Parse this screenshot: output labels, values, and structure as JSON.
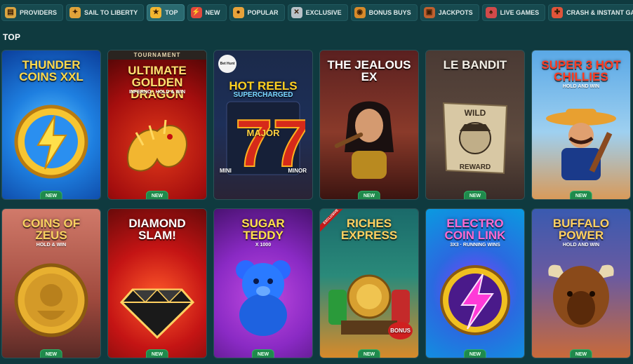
{
  "categories": [
    {
      "label": "Providers",
      "icon": "providers-icon",
      "color": "#d9a441",
      "active": false
    },
    {
      "label": "Sail to Liberty",
      "icon": "compass-icon",
      "color": "#e0a33a",
      "active": false
    },
    {
      "label": "Top",
      "icon": "star-icon",
      "color": "#f2b530",
      "active": true
    },
    {
      "label": "New",
      "icon": "lightning-icon",
      "color": "#e2483c",
      "active": false
    },
    {
      "label": "Popular",
      "icon": "coin-icon",
      "color": "#e8a23a",
      "active": false
    },
    {
      "label": "Exclusive",
      "icon": "crossed-swords-icon",
      "color": "#b9c2c8",
      "active": false
    },
    {
      "label": "Bonus Buys",
      "icon": "coin-bag-icon",
      "color": "#d88a2a",
      "active": false
    },
    {
      "label": "Jackpots",
      "icon": "treasure-chest-icon",
      "color": "#c0602e",
      "active": false
    },
    {
      "label": "Live Games",
      "icon": "cards-icon",
      "color": "#d24a4a",
      "active": false
    },
    {
      "label": "Crash & Instant Games",
      "icon": "gamepad-icon",
      "color": "#e0543a",
      "active": false
    }
  ],
  "section": {
    "title": "TOP"
  },
  "games": [
    {
      "name": "Thunder Coins XXL",
      "line1": "Thunder",
      "line2": "Coins XXL",
      "badge": "NEW",
      "theme": "blue"
    },
    {
      "name": "Ultimate Golden Dragon Inferno",
      "ribbon": "TOURNAMENT",
      "line1": "Ultimate",
      "line2": "Golden Dragon",
      "subtitle": "Inferno · Hold & Win",
      "badge": "NEW",
      "theme": "red"
    },
    {
      "name": "Hot Reels Supercharged",
      "logo": "Bet Hunt",
      "line1": "Hot Reels",
      "line2": "Supercharged",
      "major": "MAJOR",
      "mini": "MINI",
      "minor": "MINOR",
      "badge": "",
      "theme": "navy"
    },
    {
      "name": "The Jealous Ex",
      "line1": "The Jealous Ex",
      "badge": "NEW",
      "theme": "maroon"
    },
    {
      "name": "Le Bandit",
      "line1": "Le Bandit",
      "wild": "WILD",
      "reward": "REWARD",
      "badge": "NEW",
      "theme": "stone"
    },
    {
      "name": "Super 3 Hot Chillies",
      "line1": "Super 3 Hot",
      "line2": "Chillies",
      "subtitle": "Hold and Win",
      "badge": "NEW",
      "theme": "sky"
    },
    {
      "name": "Coins of Zeus",
      "line1": "Coins of",
      "line2": "Zeus",
      "subtitle": "Hold & Win",
      "badge": "NEW",
      "theme": "rose"
    },
    {
      "name": "Diamond Slam!",
      "line1": "Diamond",
      "line2": "Slam!",
      "badge": "NEW",
      "theme": "crimson"
    },
    {
      "name": "Sugar Teddy x1000",
      "line1": "Sugar",
      "line2": "Teddy",
      "subtitle": "x 1000",
      "badge": "NEW",
      "theme": "purple"
    },
    {
      "name": "Riches Express",
      "corner": "EXCLUSIVE",
      "line1": "Riches",
      "line2": "Express",
      "bonus": "BONUS",
      "badge": "NEW",
      "theme": "teal"
    },
    {
      "name": "Electro Coin Link",
      "line1": "Electro",
      "line2": "Coin Link",
      "subtitle": "3x3 · Running Wins",
      "badge": "NEW",
      "theme": "cyan"
    },
    {
      "name": "Buffalo Power",
      "line1": "Buffalo",
      "line2": "Power",
      "subtitle": "Hold and Win",
      "badge": "NEW",
      "theme": "dusk"
    }
  ]
}
